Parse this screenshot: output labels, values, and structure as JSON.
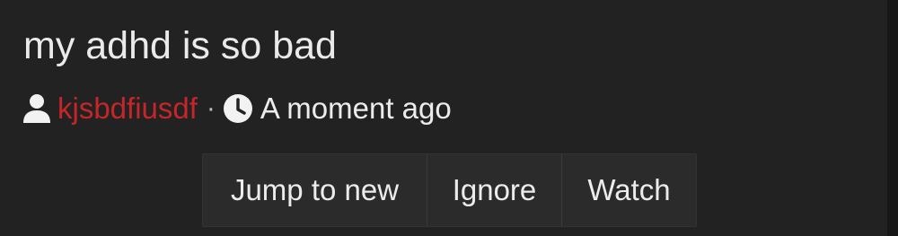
{
  "thread": {
    "title": "my adhd is so bad",
    "author": "kjsbdfiusdf",
    "separator": "·",
    "timestamp": "A moment ago"
  },
  "icons": {
    "author": "user-icon",
    "timestamp": "clock-icon"
  },
  "actions": {
    "jump_to_new": "Jump to new",
    "ignore": "Ignore",
    "watch": "Watch"
  },
  "colors": {
    "background": "#222222",
    "author_link": "#c4262a",
    "text": "#ececec",
    "button_background": "#2b2b2b"
  }
}
